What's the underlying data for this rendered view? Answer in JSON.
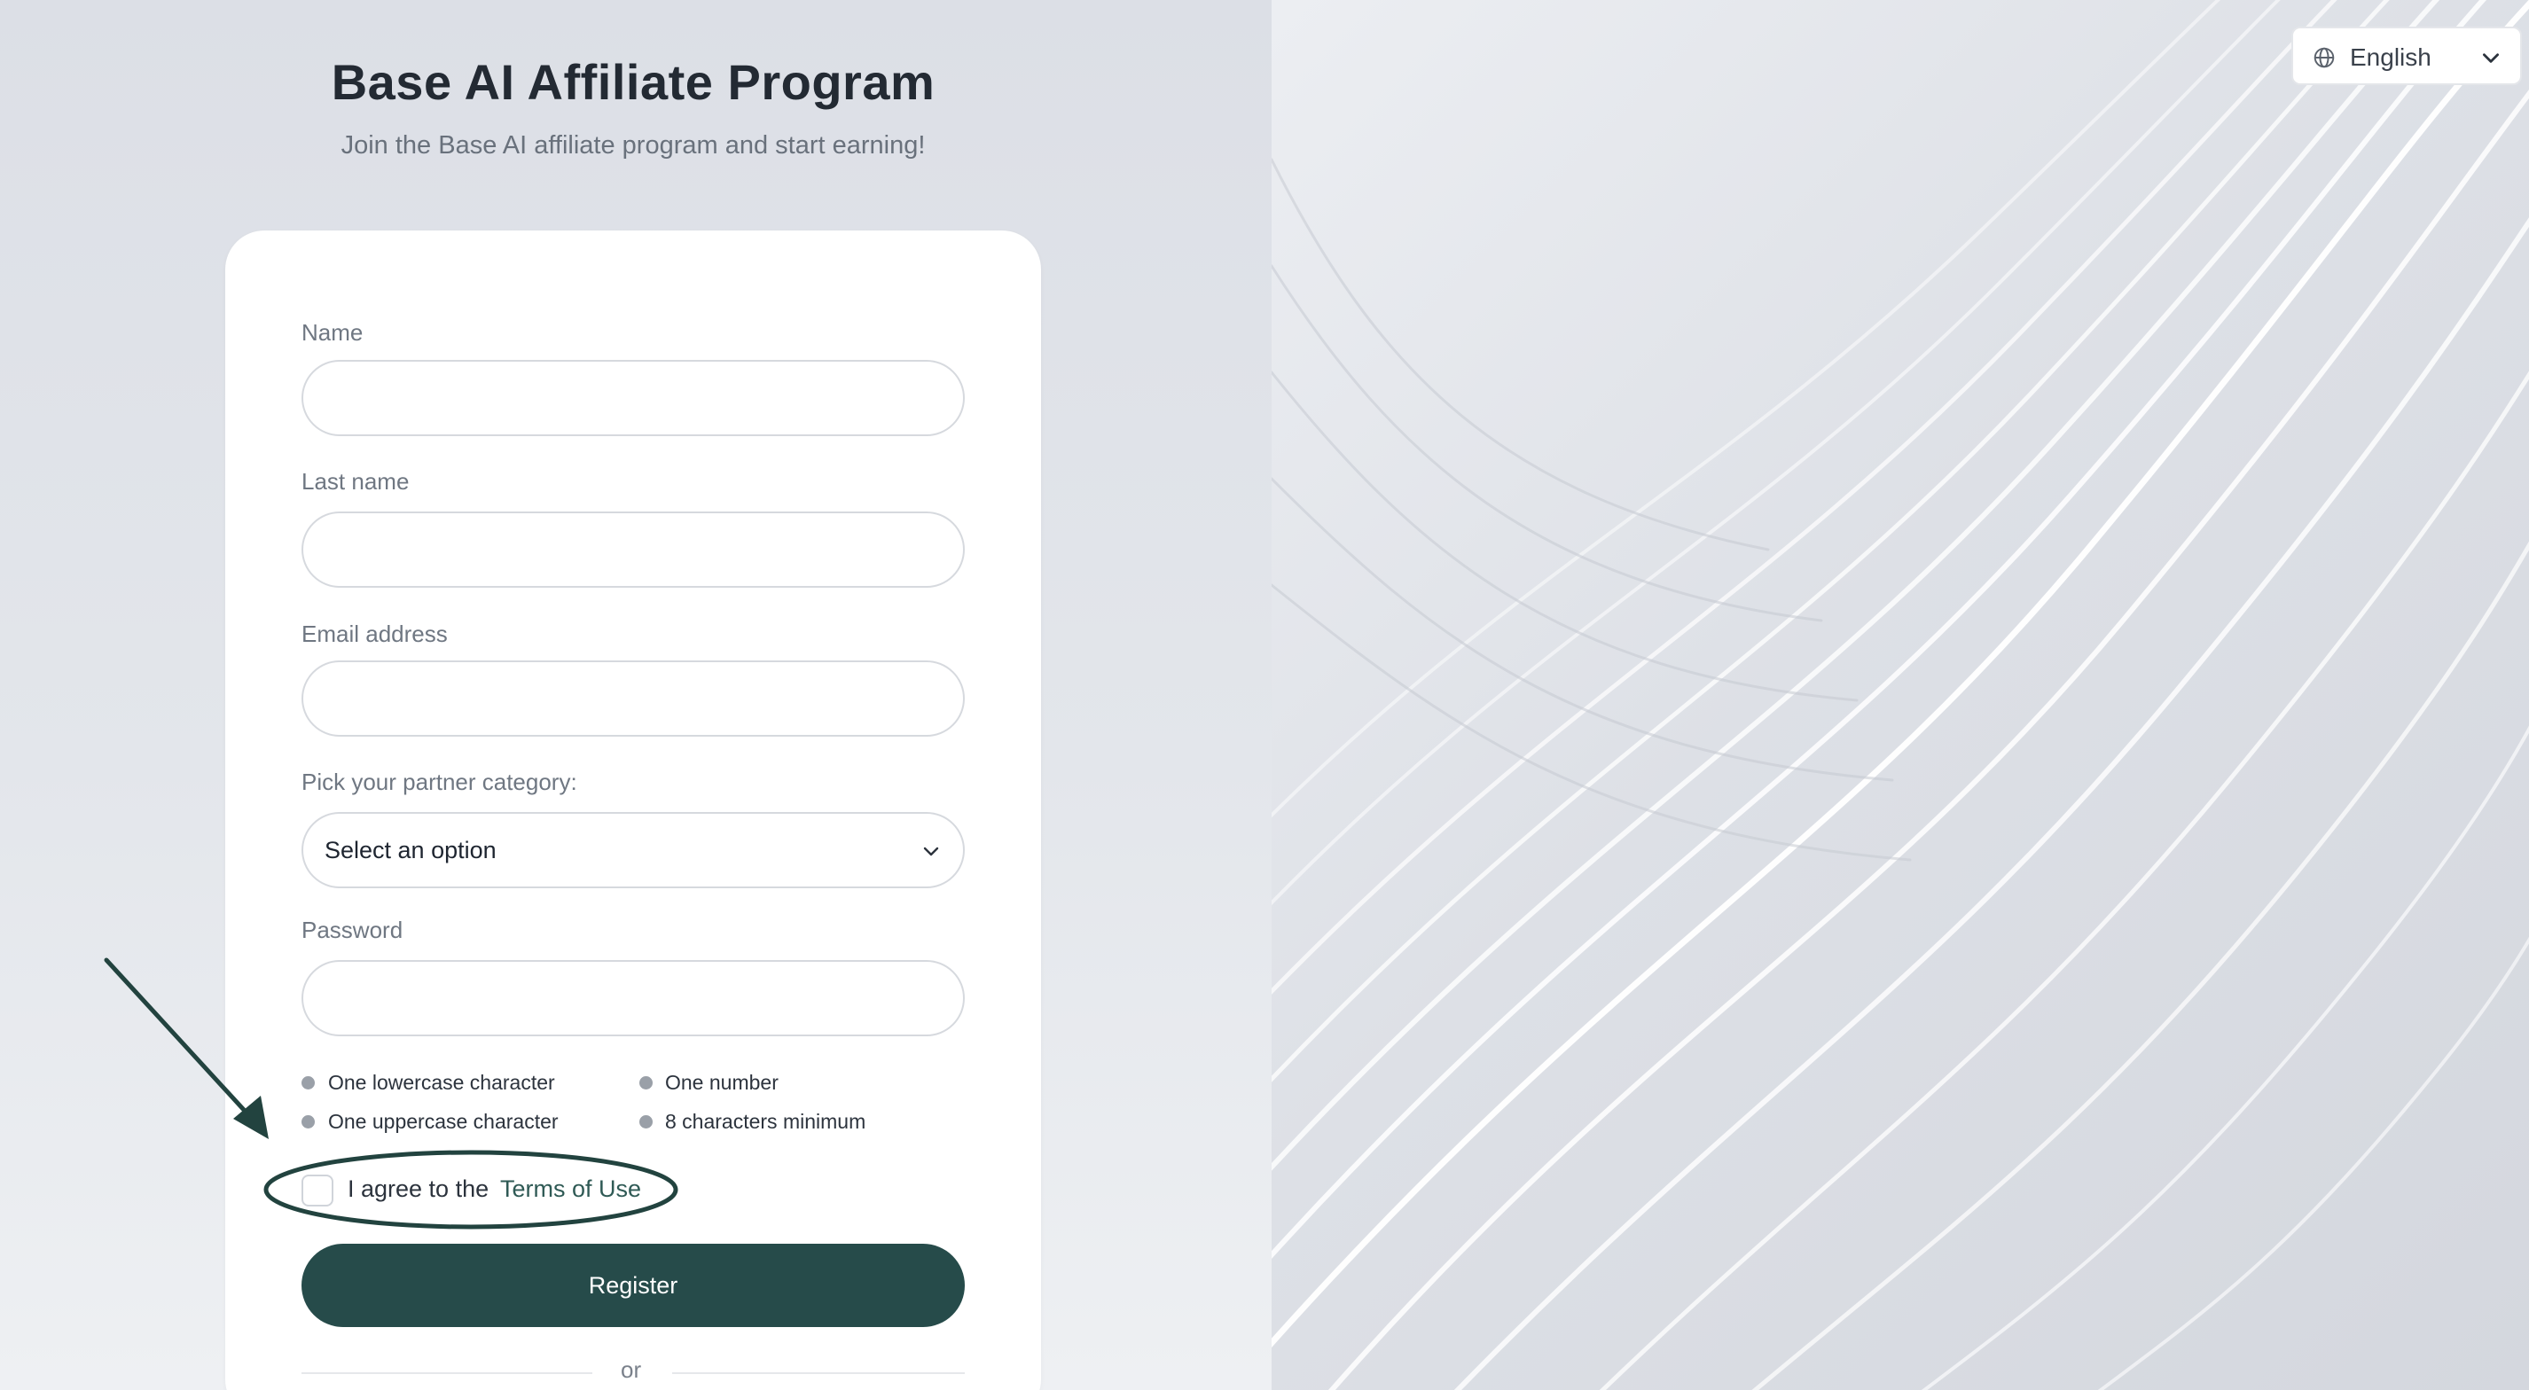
{
  "header": {
    "title": "Base AI Affiliate Program",
    "subtitle": "Join the Base AI affiliate program and start earning!"
  },
  "form": {
    "name_label": "Name",
    "name_value": "",
    "last_name_label": "Last name",
    "last_name_value": "",
    "email_label": "Email address",
    "email_value": "",
    "category_label": "Pick your partner category:",
    "category_selected": "Select an option",
    "password_label": "Password",
    "password_value": "",
    "requirements": [
      "One lowercase character",
      "One number",
      "One uppercase character",
      "8 characters minimum"
    ],
    "agree_text": "I agree to the",
    "terms_link": "Terms of Use",
    "terms_checked": false,
    "register_label": "Register",
    "divider_text": "or"
  },
  "language": {
    "selected": "English"
  },
  "colors": {
    "primary": "#264b4a",
    "annotation": "#22433f",
    "link": "#2f5a55"
  },
  "icons": [
    "chevron-down-icon",
    "globe-icon"
  ]
}
